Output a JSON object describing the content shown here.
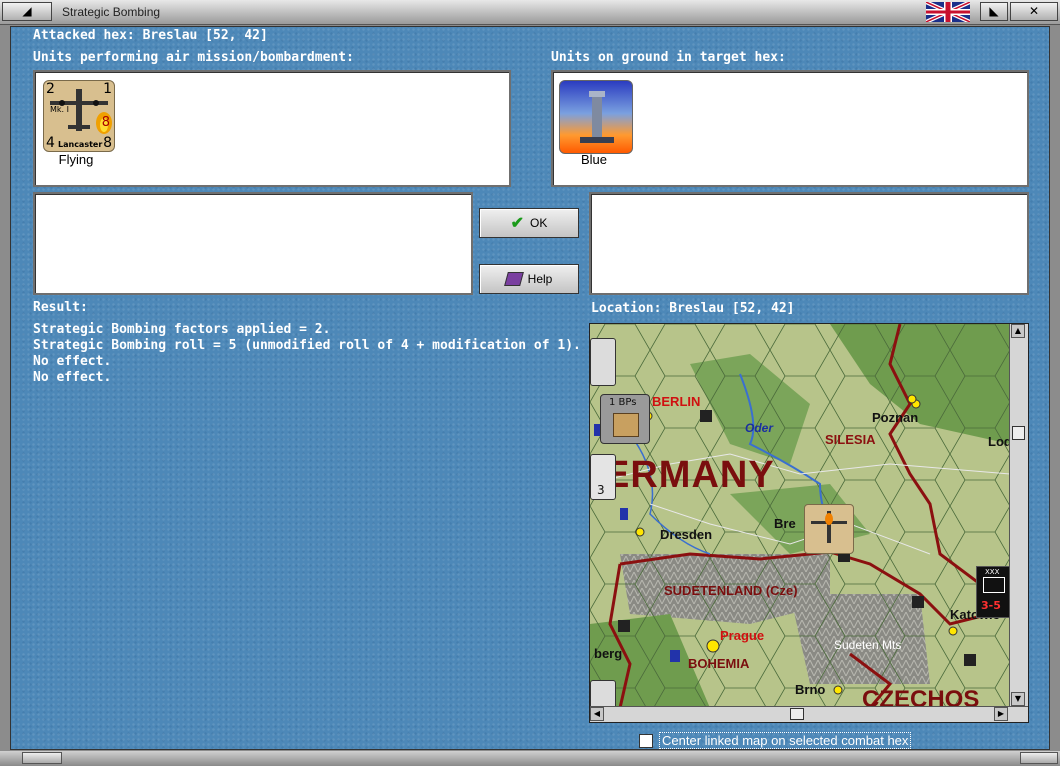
{
  "window": {
    "title": "Strategic Bombing"
  },
  "labels": {
    "attacked_hex": "Attacked hex: Breslau  [52, 42]",
    "air_units": "Units performing air mission/bombardment:",
    "ground_units": "Units on ground in target hex:",
    "result": "Result:",
    "location": "Location:  Breslau  [52, 42]"
  },
  "air_unit": {
    "caption": "Flying",
    "attack": "2",
    "range": "1",
    "defense": "4",
    "move": "8",
    "name": "Lancaster",
    "mk": "Mk. I",
    "value": "8"
  },
  "ground_unit": {
    "caption": "Blue"
  },
  "buttons": {
    "ok": "OK",
    "help": "Help"
  },
  "results": [
    "Strategic Bombing factors applied = 2.",
    "Strategic Bombing roll = 5 (unmodified roll of 4 + modification of 1).",
    "No effect.",
    "No effect."
  ],
  "map": {
    "labels": {
      "berlin": "BERLIN",
      "oder": "Oder",
      "silesia": "SILESIA",
      "poznan": "Poznan",
      "lod": "Lod",
      "germany": "ERMANY",
      "dresden": "Dresden",
      "bre": "Bre",
      "sudetenland": "SUDETENLAND (Cze)",
      "katowice": "Katowic",
      "prague": "Prague",
      "bohemia": "BOHEMIA",
      "sudeten": "Sudeten Mts",
      "berg": "berg",
      "brno": "Brno",
      "czech": "CZECHOS",
      "bps": "1 BPs",
      "corps_val": "3-5",
      "corps_size": "XXX",
      "unit_small": "3"
    }
  },
  "checkbox": {
    "label": "Center linked map on selected combat hex",
    "checked": false
  },
  "colors": {
    "background": "#4d88b8",
    "map_border_red": "#8b1010"
  }
}
